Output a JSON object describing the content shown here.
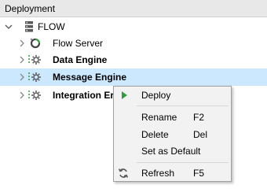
{
  "panel": {
    "title": "Deployment"
  },
  "tree": {
    "root": {
      "label": "FLOW"
    },
    "items": [
      {
        "label": "Flow Server",
        "bold": false
      },
      {
        "label": "Data Engine",
        "bold": true
      },
      {
        "label": "Message Engine",
        "bold": true,
        "selected": true
      },
      {
        "label": "Integration Er",
        "bold": true
      }
    ]
  },
  "context_menu": {
    "items": [
      {
        "label": "Deploy",
        "shortcut": ""
      },
      {
        "label": "Rename",
        "shortcut": "F2"
      },
      {
        "label": "Delete",
        "shortcut": "Del"
      },
      {
        "label": "Set as Default",
        "shortcut": ""
      },
      {
        "label": "Refresh",
        "shortcut": "F5"
      }
    ]
  },
  "colors": {
    "selected_row": "#cce8ff",
    "deploy_icon": "#2e9e3b",
    "header": "#e8e8e8"
  }
}
